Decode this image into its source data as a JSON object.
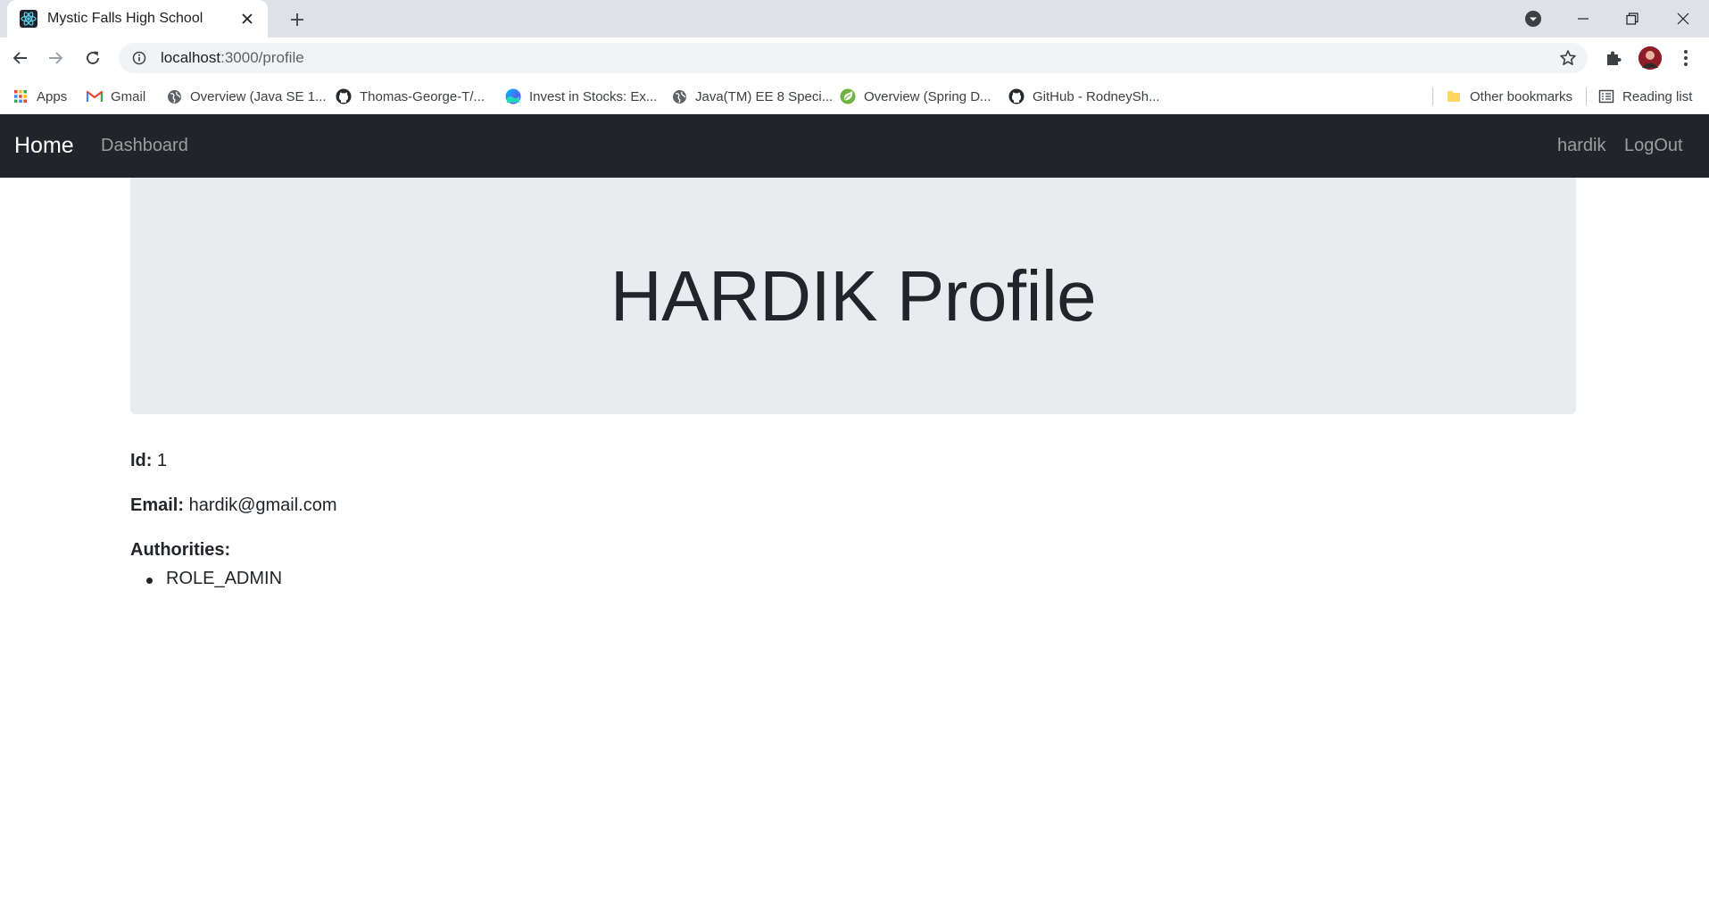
{
  "browser": {
    "tab": {
      "title": "Mystic Falls High School"
    },
    "address": {
      "host": "localhost",
      "path": ":3000/profile"
    },
    "bookmarks": [
      {
        "label": "Apps",
        "icon": "apps-grid-icon"
      },
      {
        "label": "Gmail",
        "icon": "gmail-icon"
      },
      {
        "label": "Overview (Java SE 1...",
        "icon": "globe-icon"
      },
      {
        "label": "Thomas-George-T/...",
        "icon": "github-icon"
      },
      {
        "label": "Invest in Stocks: Ex...",
        "icon": "stocks-icon"
      },
      {
        "label": "Java(TM) EE 8 Speci...",
        "icon": "globe-icon"
      },
      {
        "label": "Overview (Spring D...",
        "icon": "spring-icon"
      },
      {
        "label": "GitHub - RodneySh...",
        "icon": "github-icon"
      }
    ],
    "other_bookmarks": "Other bookmarks",
    "reading_list": "Reading list"
  },
  "navbar": {
    "brand": "Home",
    "links": [
      "Dashboard"
    ],
    "user": "hardik",
    "logout": "LogOut",
    "bg_color": "#212529"
  },
  "profile": {
    "username": "HARDIK",
    "heading_suffix": "Profile",
    "id_label": "Id:",
    "id": "1",
    "email_label": "Email:",
    "email": "hardik@gmail.com",
    "authorities_label": "Authorities:",
    "authorities": [
      "ROLE_ADMIN"
    ]
  }
}
